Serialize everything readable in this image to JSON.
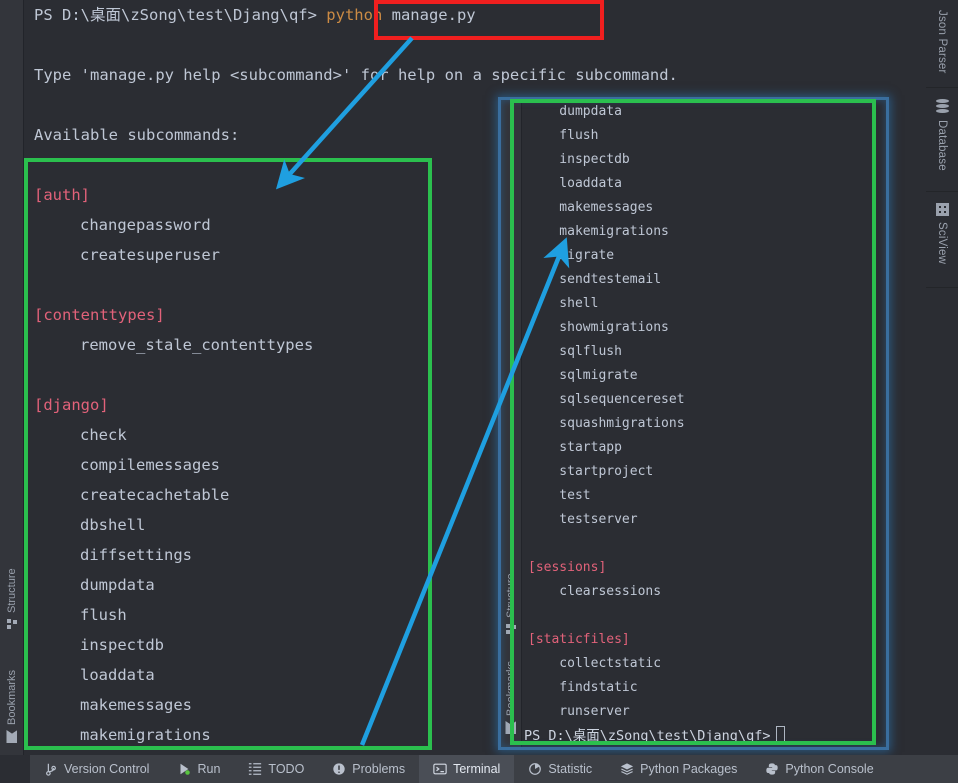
{
  "terminal": {
    "prompt_prefix": "PS D:\\桌面\\zSong\\test\\Djang\\qf> ",
    "command_keyword": "python",
    "command_arg": " manage.py",
    "help_line": "Type 'manage.py help <subcommand>' for help on a specific subcommand.",
    "available_label": "Available subcommands:",
    "sections": [
      {
        "header": "[auth]",
        "commands": [
          "changepassword",
          "createsuperuser"
        ]
      },
      {
        "header": "[contenttypes]",
        "commands": [
          "remove_stale_contenttypes"
        ]
      },
      {
        "header": "[django]",
        "commands": [
          "check",
          "compilemessages",
          "createcachetable",
          "dbshell",
          "diffsettings",
          "dumpdata",
          "flush",
          "inspectdb",
          "loaddata",
          "makemessages",
          "makemigrations"
        ]
      }
    ]
  },
  "inset": {
    "lines": [
      {
        "text": "    dumpdata",
        "kind": "cmd"
      },
      {
        "text": "    flush",
        "kind": "cmd"
      },
      {
        "text": "    inspectdb",
        "kind": "cmd"
      },
      {
        "text": "    loaddata",
        "kind": "cmd"
      },
      {
        "text": "    makemessages",
        "kind": "cmd"
      },
      {
        "text": "    makemigrations",
        "kind": "cmd"
      },
      {
        "text": "    migrate",
        "kind": "cmd"
      },
      {
        "text": "    sendtestemail",
        "kind": "cmd"
      },
      {
        "text": "    shell",
        "kind": "cmd"
      },
      {
        "text": "    showmigrations",
        "kind": "cmd"
      },
      {
        "text": "    sqlflush",
        "kind": "cmd"
      },
      {
        "text": "    sqlmigrate",
        "kind": "cmd"
      },
      {
        "text": "    sqlsequencereset",
        "kind": "cmd"
      },
      {
        "text": "    squashmigrations",
        "kind": "cmd"
      },
      {
        "text": "    startapp",
        "kind": "cmd"
      },
      {
        "text": "    startproject",
        "kind": "cmd"
      },
      {
        "text": "    test",
        "kind": "cmd"
      },
      {
        "text": "    testserver",
        "kind": "cmd"
      },
      {
        "text": "",
        "kind": "blank"
      },
      {
        "text": "[sessions]",
        "kind": "header"
      },
      {
        "text": "    clearsessions",
        "kind": "cmd"
      },
      {
        "text": "",
        "kind": "blank"
      },
      {
        "text": "[staticfiles]",
        "kind": "header"
      },
      {
        "text": "    collectstatic",
        "kind": "cmd"
      },
      {
        "text": "    findstatic",
        "kind": "cmd"
      },
      {
        "text": "    runserver",
        "kind": "cmd"
      }
    ],
    "prompt": "PS D:\\桌面\\zSong\\test\\Djang\\qf>"
  },
  "left_gutter": {
    "tabs": [
      {
        "label": "Structure",
        "icon": "structure-icon"
      },
      {
        "label": "Bookmarks",
        "icon": "bookmark-icon"
      }
    ]
  },
  "inset_gutter": {
    "tabs": [
      {
        "label": "Structure",
        "icon": "structure-icon"
      },
      {
        "label": "Bookmarks",
        "icon": "bookmark-icon"
      }
    ]
  },
  "right_strip": {
    "tabs": [
      {
        "label": "Json Parser",
        "icon": "none"
      },
      {
        "label": "Database",
        "icon": "database-icon"
      },
      {
        "label": "SciView",
        "icon": "grid-icon"
      }
    ]
  },
  "status_bar": {
    "items": [
      {
        "label": "Version Control",
        "icon": "branch-icon",
        "active": false
      },
      {
        "label": "Run",
        "icon": "run-icon",
        "active": false
      },
      {
        "label": "TODO",
        "icon": "list-icon",
        "active": false
      },
      {
        "label": "Problems",
        "icon": "warning-icon",
        "active": false
      },
      {
        "label": "Terminal",
        "icon": "terminal-icon",
        "active": true
      },
      {
        "label": "Statistic",
        "icon": "pie-icon",
        "active": false
      },
      {
        "label": "Python Packages",
        "icon": "layers-icon",
        "active": false
      },
      {
        "label": "Python Console",
        "icon": "python-icon",
        "active": false
      }
    ]
  },
  "annotations": {
    "red_box_color": "#f01f1f",
    "green_box_color": "#2bbf4e",
    "blue_box_color": "#3a6e9e",
    "arrow_color": "#1f9fe0"
  }
}
